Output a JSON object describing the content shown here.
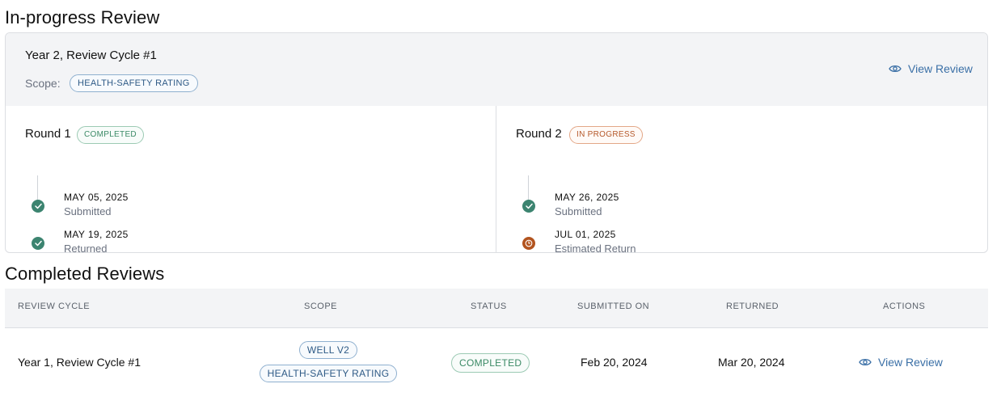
{
  "in_progress": {
    "section_title": "In-progress Review",
    "cycle_title": "Year 2, Review Cycle #1",
    "scope_label": "Scope:",
    "scope_pill": "HEALTH-SAFETY RATING",
    "view_review": "View Review",
    "rounds": [
      {
        "title": "Round 1",
        "status": "COMPLETED",
        "status_color": "#3b8a66",
        "steps": [
          {
            "date": "MAY 05, 2025",
            "label": "Submitted",
            "state": "done"
          },
          {
            "date": "MAY 19, 2025",
            "label": "Returned",
            "state": "done"
          }
        ]
      },
      {
        "title": "Round 2",
        "status": "IN PROGRESS",
        "status_color": "#b5582a",
        "steps": [
          {
            "date": "MAY 26, 2025",
            "label": "Submitted",
            "state": "done"
          },
          {
            "date": "JUL 01, 2025",
            "label": "Estimated Return",
            "state": "pending"
          }
        ]
      }
    ]
  },
  "completed": {
    "section_title": "Completed Reviews",
    "columns": [
      "REVIEW CYCLE",
      "SCOPE",
      "STATUS",
      "SUBMITTED ON",
      "RETURNED",
      "ACTIONS"
    ],
    "rows": [
      {
        "review_cycle": "Year 1, Review Cycle #1",
        "scopes": [
          "WELL V2",
          "HEALTH-SAFETY RATING"
        ],
        "status": "COMPLETED",
        "submitted_on": "Feb 20, 2024",
        "returned": "Mar 20, 2024",
        "action": "View Review"
      }
    ]
  },
  "icons": {
    "view": "eye-icon",
    "done": "check-circle-icon",
    "pending": "clock-icon"
  },
  "colors": {
    "link": "#3a6fa6",
    "done": "#3c8470",
    "pending": "#b2541f",
    "header_bg": "#f3f4f6"
  }
}
